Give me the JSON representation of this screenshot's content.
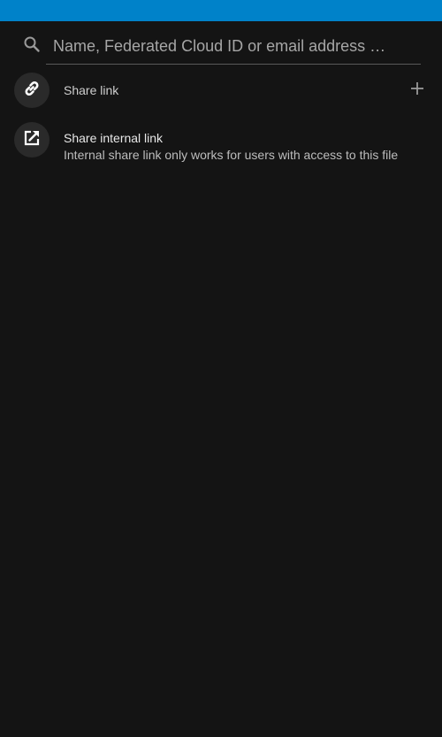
{
  "colors": {
    "accent": "#0082c9",
    "background": "#141414",
    "avatar_bg": "#2a2a2a"
  },
  "search": {
    "placeholder": "Name, Federated Cloud ID or email address …",
    "icon": "search-icon"
  },
  "share_link": {
    "title": "Share link",
    "icon": "link-icon",
    "action_icon": "plus-icon"
  },
  "internal_link": {
    "title": "Share internal link",
    "subtitle": "Internal share link only works for users with access to this file",
    "icon": "external-link-icon"
  }
}
